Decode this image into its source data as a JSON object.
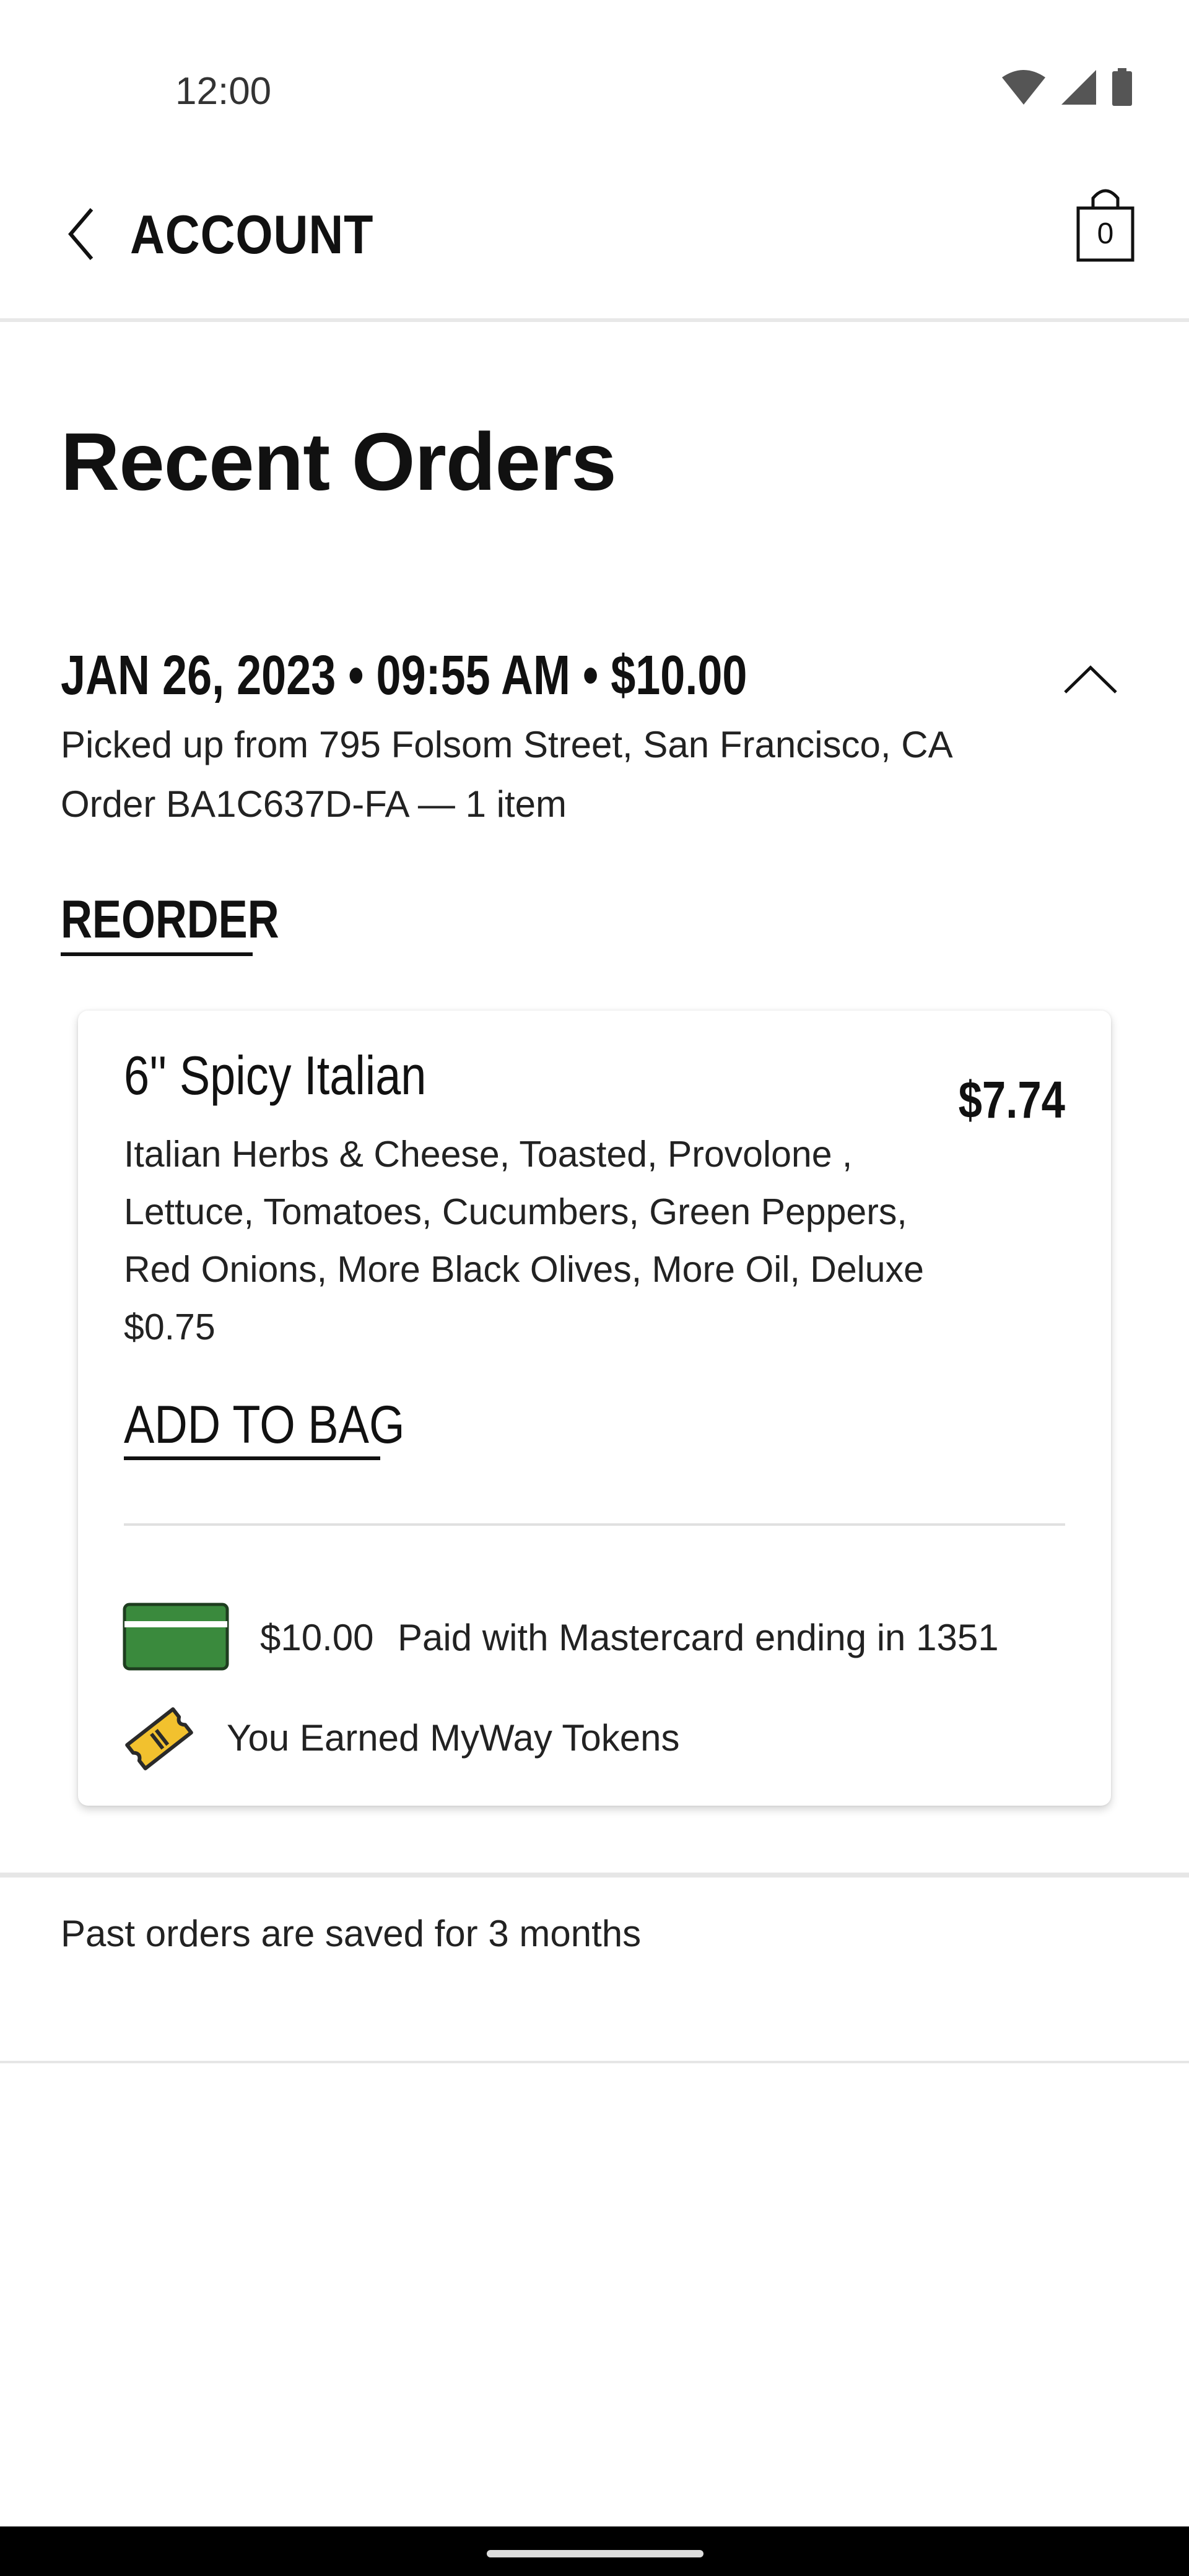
{
  "status_bar": {
    "time": "12:00",
    "icons": [
      "wifi-icon",
      "cell-signal-icon",
      "battery-icon"
    ]
  },
  "header": {
    "back_icon": "chevron-left-icon",
    "title": "ACCOUNT",
    "bag_icon": "shopping-bag-icon",
    "bag_count": "0"
  },
  "page": {
    "title": "Recent Orders"
  },
  "order": {
    "summary": "JAN 26, 2023 • 09:55 AM • $10.00",
    "pickup": "Picked up from 795 Folsom Street, San Francisco, CA",
    "order_line": "Order BA1C637D-FA  — 1 item",
    "reorder_label": "REORDER",
    "collapse_icon": "chevron-up-icon",
    "item": {
      "name": "6'' Spicy Italian",
      "price": "$7.74",
      "description": "Italian Herbs & Cheese, Toasted, Provolone , Lettuce, Tomatoes, Cucumbers, Green Peppers, Red Onions, More Black Olives, More Oil, Deluxe $0.75",
      "add_to_bag_label": "ADD TO BAG"
    },
    "payment": {
      "card_icon": "credit-card-icon",
      "amount": "$10.00",
      "text": "Paid with Mastercard ending in 1351"
    },
    "tokens": {
      "icon": "ticket-icon",
      "text": "You Earned MyWay Tokens"
    }
  },
  "footer": {
    "note": "Past orders are saved for 3 months"
  },
  "colors": {
    "card_green": "#3a8a3d",
    "token_yellow": "#f2c12e",
    "text": "#111111"
  }
}
